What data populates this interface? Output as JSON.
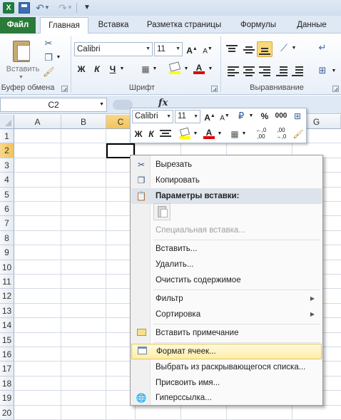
{
  "qat": {
    "app_icon": "excel-logo-icon",
    "app_letter": "X",
    "undo_glyph": "↶",
    "redo_glyph": "↷"
  },
  "tabs": {
    "file": "Файл",
    "items": [
      "Главная",
      "Вставка",
      "Разметка страницы",
      "Формулы",
      "Данные"
    ],
    "active": "Главная"
  },
  "ribbon": {
    "clipboard": {
      "paste_label": "Вставить",
      "group_label": "Буфер обмена"
    },
    "font": {
      "name": "Calibri",
      "size": "11",
      "bold": "Ж",
      "italic": "К",
      "underline": "Ч",
      "group_label": "Шрифт"
    },
    "alignment": {
      "group_label": "Выравнивание"
    }
  },
  "formula_bar": {
    "name_box": "C2",
    "fx": "fx"
  },
  "grid": {
    "columns": [
      "A",
      "B",
      "C",
      "D",
      "E",
      "F",
      "G"
    ],
    "rows": [
      "1",
      "2",
      "3",
      "4",
      "5",
      "6",
      "7",
      "8",
      "9",
      "10",
      "11",
      "12",
      "13",
      "14",
      "15",
      "16",
      "17",
      "18",
      "19",
      "20"
    ],
    "selected_cell": "C2"
  },
  "mini_toolbar": {
    "font_name": "Calibri",
    "font_size": "11",
    "bold": "Ж",
    "italic": "К",
    "percent": "%",
    "thousands": "000",
    "inc_decimal": "←,0 ,00",
    "dec_decimal": ",00 →,0"
  },
  "context_menu": {
    "cut": "Вырезать",
    "copy": "Копировать",
    "paste_options": "Параметры вставки:",
    "paste_special": "Специальная вставка...",
    "insert": "Вставить...",
    "delete": "Удалить...",
    "clear": "Очистить содержимое",
    "filter": "Фильтр",
    "sort": "Сортировка",
    "insert_comment": "Вставить примечание",
    "format_cells": "Формат ячеек...",
    "pick_from_list": "Выбрать из раскрывающегося списка...",
    "define_name": "Присвоить имя...",
    "hyperlink": "Гиперссылка...",
    "hover_color": "#ffeea6"
  },
  "colors": {
    "file_tab": "#2a7a3a",
    "selection_header": "#f2c359",
    "highlight_yellow": "#ffff00",
    "font_red": "#e00000"
  }
}
